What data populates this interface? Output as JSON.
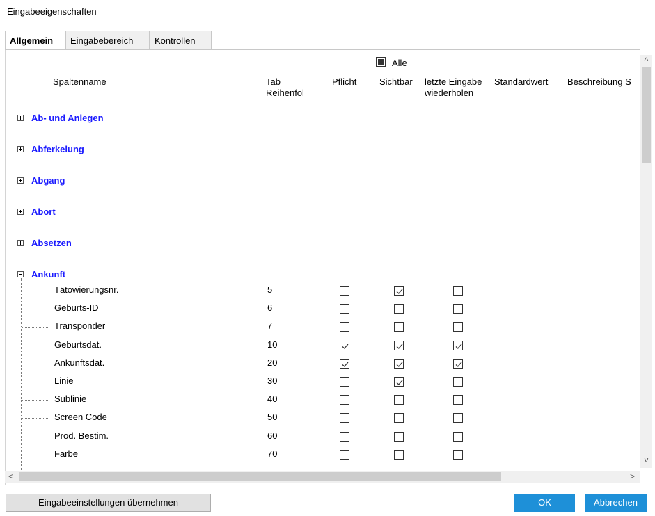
{
  "window": {
    "title": "Eingabeeigenschaften"
  },
  "tabs": [
    {
      "label": "Allgemein",
      "active": true
    },
    {
      "label": "Eingabebereich",
      "active": false
    },
    {
      "label": "Kontrollen",
      "active": false
    }
  ],
  "header": {
    "all_label": "Alle",
    "col_name": "Spaltenname",
    "col_tab": "Tab\nReihenfol",
    "col_required": "Pflicht",
    "col_visible": "Sichtbar",
    "col_repeat": "letzte Eingabe\nwiederholen",
    "col_default": "Standardwert",
    "col_desc": "Beschreibung S"
  },
  "groups": [
    {
      "label": "Ab- und Anlegen",
      "expanded": false
    },
    {
      "label": "Abferkelung",
      "expanded": false
    },
    {
      "label": "Abgang",
      "expanded": false
    },
    {
      "label": "Abort",
      "expanded": false
    },
    {
      "label": "Absetzen",
      "expanded": false
    },
    {
      "label": "Ankunft",
      "expanded": true
    }
  ],
  "rows": [
    {
      "name": "Tätowierungsnr.",
      "tab": "5",
      "required": false,
      "visible": true,
      "repeat": false
    },
    {
      "name": "Geburts-ID",
      "tab": "6",
      "required": false,
      "visible": false,
      "repeat": false
    },
    {
      "name": "Transponder",
      "tab": "7",
      "required": false,
      "visible": false,
      "repeat": false
    },
    {
      "name": "Geburtsdat.",
      "tab": "10",
      "required": true,
      "visible": true,
      "repeat": true
    },
    {
      "name": "Ankunftsdat.",
      "tab": "20",
      "required": true,
      "visible": true,
      "repeat": true
    },
    {
      "name": "Linie",
      "tab": "30",
      "required": false,
      "visible": true,
      "repeat": false
    },
    {
      "name": "Sublinie",
      "tab": "40",
      "required": false,
      "visible": false,
      "repeat": false
    },
    {
      "name": "Screen Code",
      "tab": "50",
      "required": false,
      "visible": false,
      "repeat": false
    },
    {
      "name": "Prod. Bestim.",
      "tab": "60",
      "required": false,
      "visible": false,
      "repeat": false
    },
    {
      "name": "Farbe",
      "tab": "70",
      "required": false,
      "visible": false,
      "repeat": false
    }
  ],
  "scroll": {
    "up_icon": "scroll-up-arrow",
    "down_icon": "scroll-down-arrow",
    "left_icon": "scroll-left-arrow",
    "right_icon": "scroll-right-arrow"
  },
  "buttons": {
    "apply": "Eingabeeinstellungen übernehmen",
    "ok": "OK",
    "cancel": "Abbrechen"
  },
  "colors": {
    "accent": "#1e90d8",
    "group_link": "#1a1aff"
  }
}
